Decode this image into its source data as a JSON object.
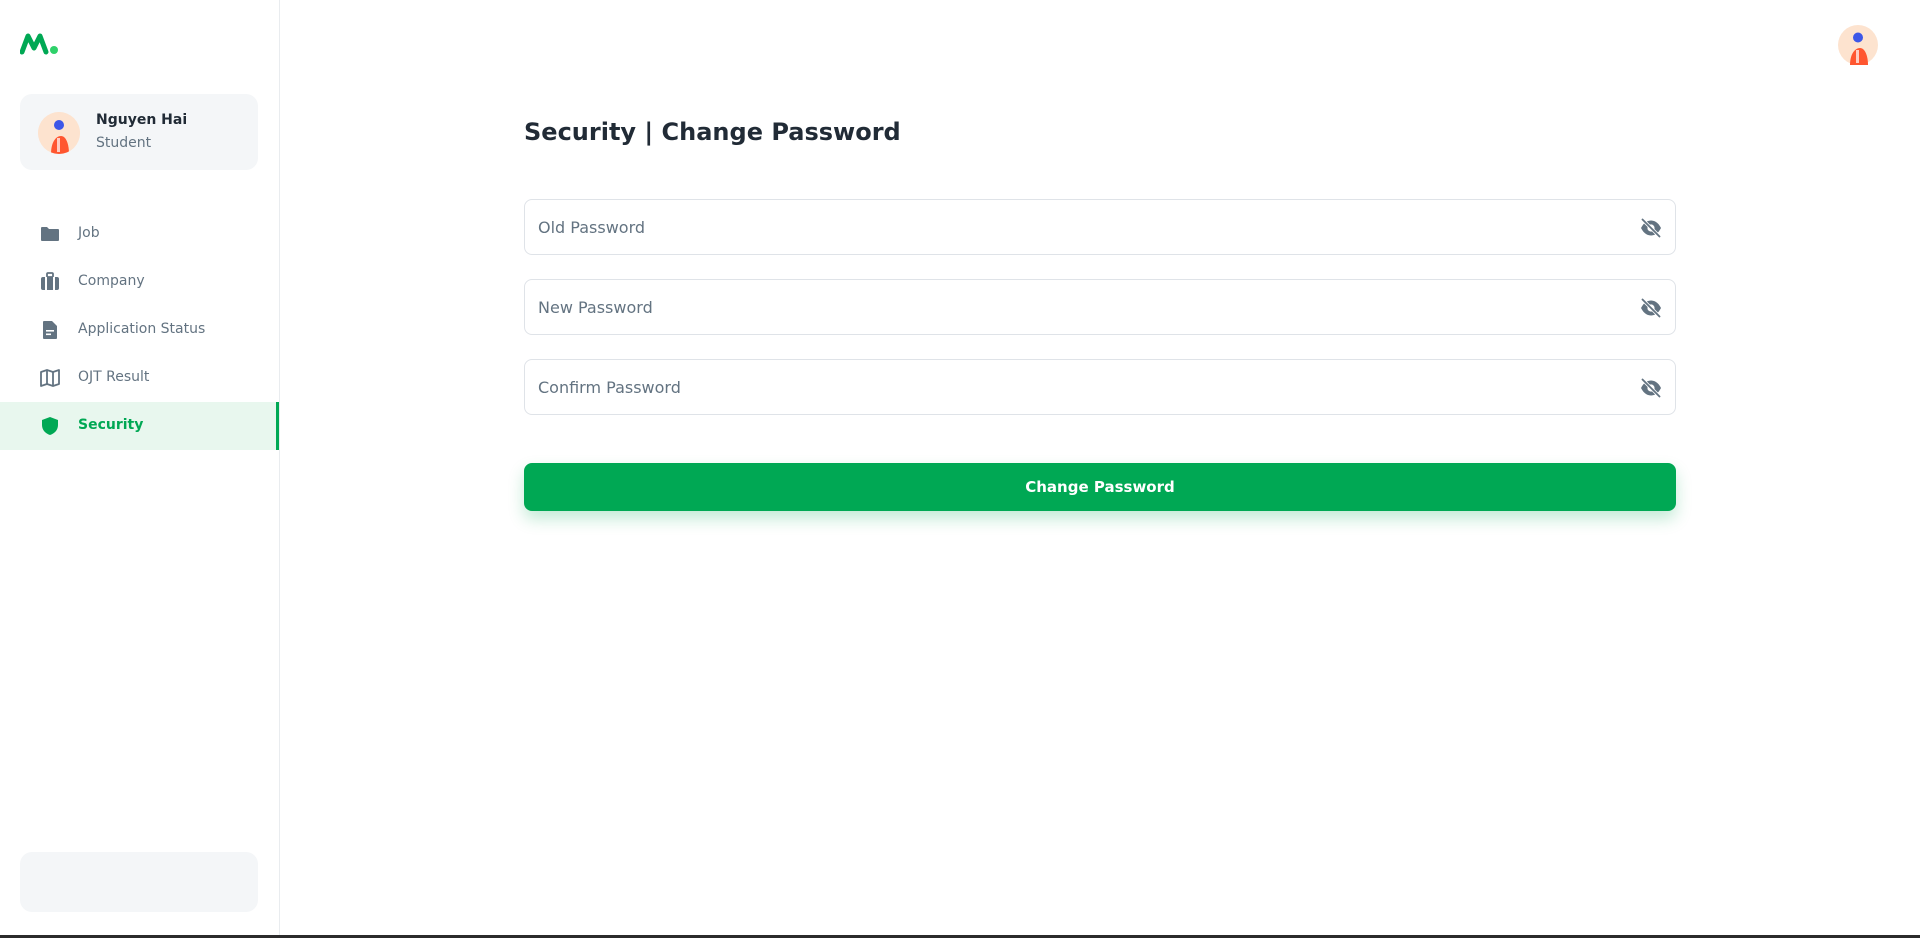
{
  "brand": {
    "logo_icon": "brand-logo-icon",
    "accent": "#00a854"
  },
  "user": {
    "name": "Nguyen Hai",
    "role": "Student",
    "avatar_icon": "user-avatar-icon"
  },
  "sidebar": {
    "items": [
      {
        "label": "Job",
        "icon": "folder-icon",
        "active": false
      },
      {
        "label": "Company",
        "icon": "briefcase-icon",
        "active": false
      },
      {
        "label": "Application Status",
        "icon": "document-icon",
        "active": false
      },
      {
        "label": "OJT Result",
        "icon": "map-icon",
        "active": false
      },
      {
        "label": "Security",
        "icon": "shield-icon",
        "active": true
      }
    ]
  },
  "page": {
    "title": "Security | Change Password",
    "fields": [
      {
        "placeholder": "Old Password",
        "value": "",
        "icon": "eye-off-icon"
      },
      {
        "placeholder": "New Password",
        "value": "",
        "icon": "eye-off-icon"
      },
      {
        "placeholder": "Confirm Password",
        "value": "",
        "icon": "eye-off-icon"
      }
    ],
    "submit_label": "Change Password"
  }
}
